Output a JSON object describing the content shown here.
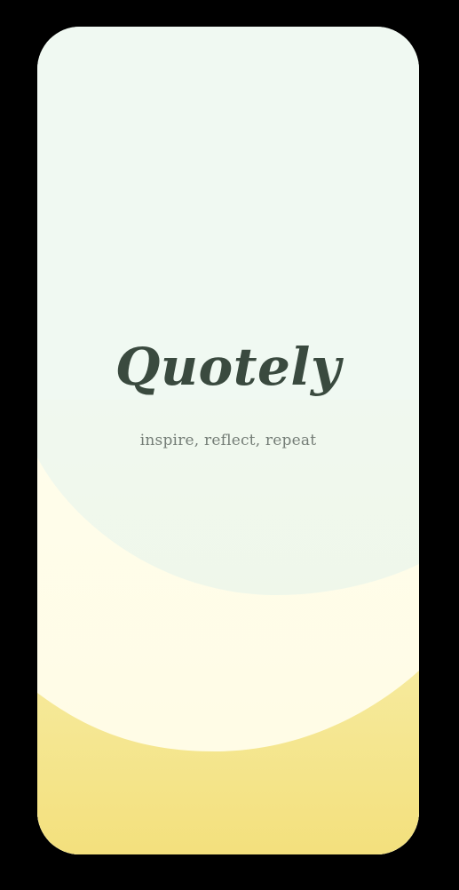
{
  "app": {
    "name": "Quotely",
    "tagline": "inspire, reflect, repeat"
  },
  "colors": {
    "frame": "#000000",
    "background_top": "#f0f9f2",
    "mint_wave": "#eef6e6",
    "cream_wave": "#fffdea",
    "yellow_wave_top": "#f5e99a",
    "yellow_wave_bottom": "#f3e07f",
    "title": "#3a4a3f",
    "tagline": "#747d76"
  }
}
